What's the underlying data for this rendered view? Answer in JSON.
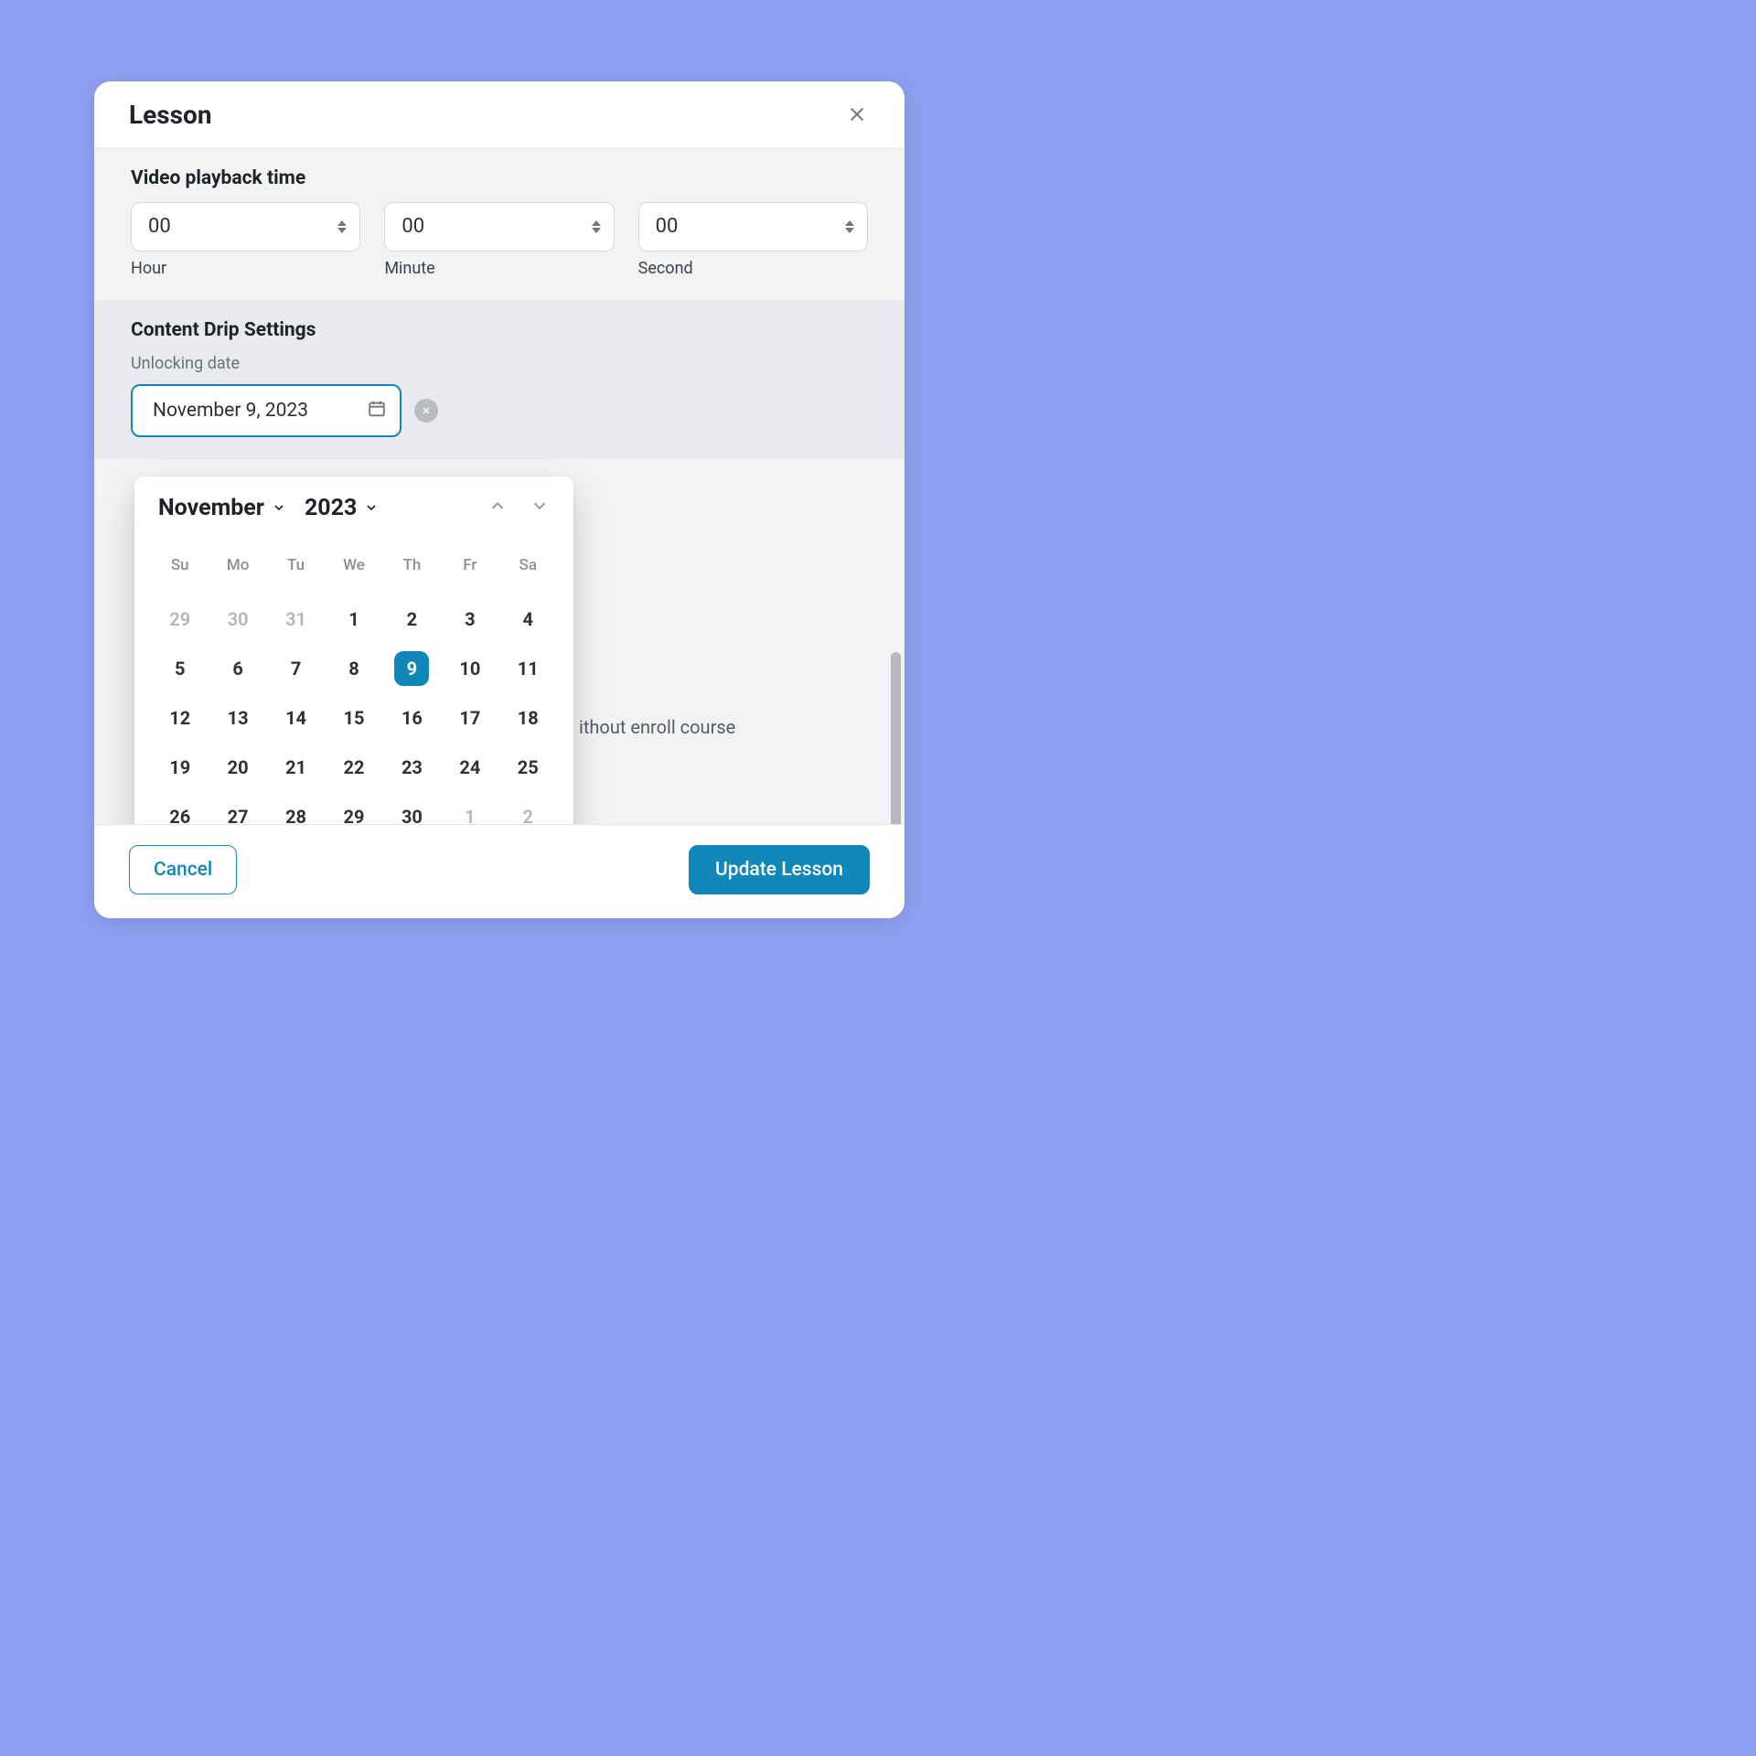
{
  "modal": {
    "title": "Lesson",
    "footer": {
      "cancel": "Cancel",
      "submit": "Update Lesson"
    }
  },
  "video": {
    "section_title": "Video playback time",
    "hour_value": "00",
    "minute_value": "00",
    "second_value": "00",
    "hour_label": "Hour",
    "minute_label": "Minute",
    "second_label": "Second"
  },
  "drip": {
    "section_title": "Content Drip Settings",
    "sub_label": "Unlocking date",
    "date_value": "November 9, 2023"
  },
  "note_tail": "ithout enroll course",
  "datepicker": {
    "month_label": "November",
    "year_label": "2023",
    "selected_day": 9,
    "dow": [
      "Su",
      "Mo",
      "Tu",
      "We",
      "Th",
      "Fr",
      "Sa"
    ],
    "grid": [
      {
        "d": 29,
        "muted": true
      },
      {
        "d": 30,
        "muted": true
      },
      {
        "d": 31,
        "muted": true
      },
      {
        "d": 1
      },
      {
        "d": 2
      },
      {
        "d": 3
      },
      {
        "d": 4
      },
      {
        "d": 5
      },
      {
        "d": 6
      },
      {
        "d": 7
      },
      {
        "d": 8
      },
      {
        "d": 9,
        "selected": true
      },
      {
        "d": 10
      },
      {
        "d": 11
      },
      {
        "d": 12
      },
      {
        "d": 13
      },
      {
        "d": 14
      },
      {
        "d": 15
      },
      {
        "d": 16
      },
      {
        "d": 17
      },
      {
        "d": 18
      },
      {
        "d": 19
      },
      {
        "d": 20
      },
      {
        "d": 21
      },
      {
        "d": 22
      },
      {
        "d": 23
      },
      {
        "d": 24
      },
      {
        "d": 25
      },
      {
        "d": 26
      },
      {
        "d": 27
      },
      {
        "d": 28
      },
      {
        "d": 29
      },
      {
        "d": 30
      },
      {
        "d": 1,
        "muted": true
      },
      {
        "d": 2,
        "muted": true
      }
    ]
  }
}
